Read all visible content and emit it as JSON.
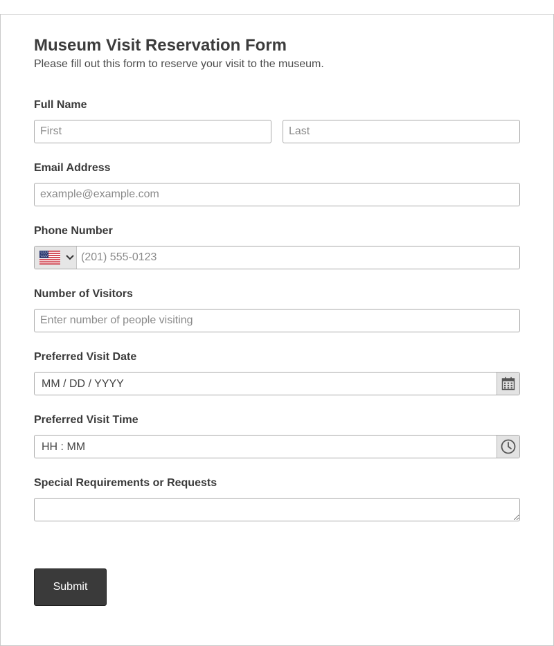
{
  "form": {
    "title": "Museum Visit Reservation Form",
    "subtitle": "Please fill out this form to reserve your visit to the museum."
  },
  "fields": {
    "full_name": {
      "label": "Full Name",
      "first_placeholder": "First",
      "last_placeholder": "Last"
    },
    "email": {
      "label": "Email Address",
      "placeholder": "example@example.com"
    },
    "phone": {
      "label": "Phone Number",
      "country_flag_icon": "us-flag-icon",
      "placeholder": "(201) 555-0123"
    },
    "visitors": {
      "label": "Number of Visitors",
      "placeholder": "Enter number of people visiting"
    },
    "visit_date": {
      "label": "Preferred Visit Date",
      "format_text": "MM / DD / YYYY",
      "icon": "calendar-icon"
    },
    "visit_time": {
      "label": "Preferred Visit Time",
      "format_text": "HH : MM",
      "icon": "clock-icon"
    },
    "requests": {
      "label": "Special Requirements or Requests",
      "value": ""
    }
  },
  "actions": {
    "submit_label": "Submit"
  },
  "colors": {
    "submit_bg": "#3a3a3a",
    "border": "#a9a9a9",
    "icon_bg": "#e3e3e3"
  }
}
